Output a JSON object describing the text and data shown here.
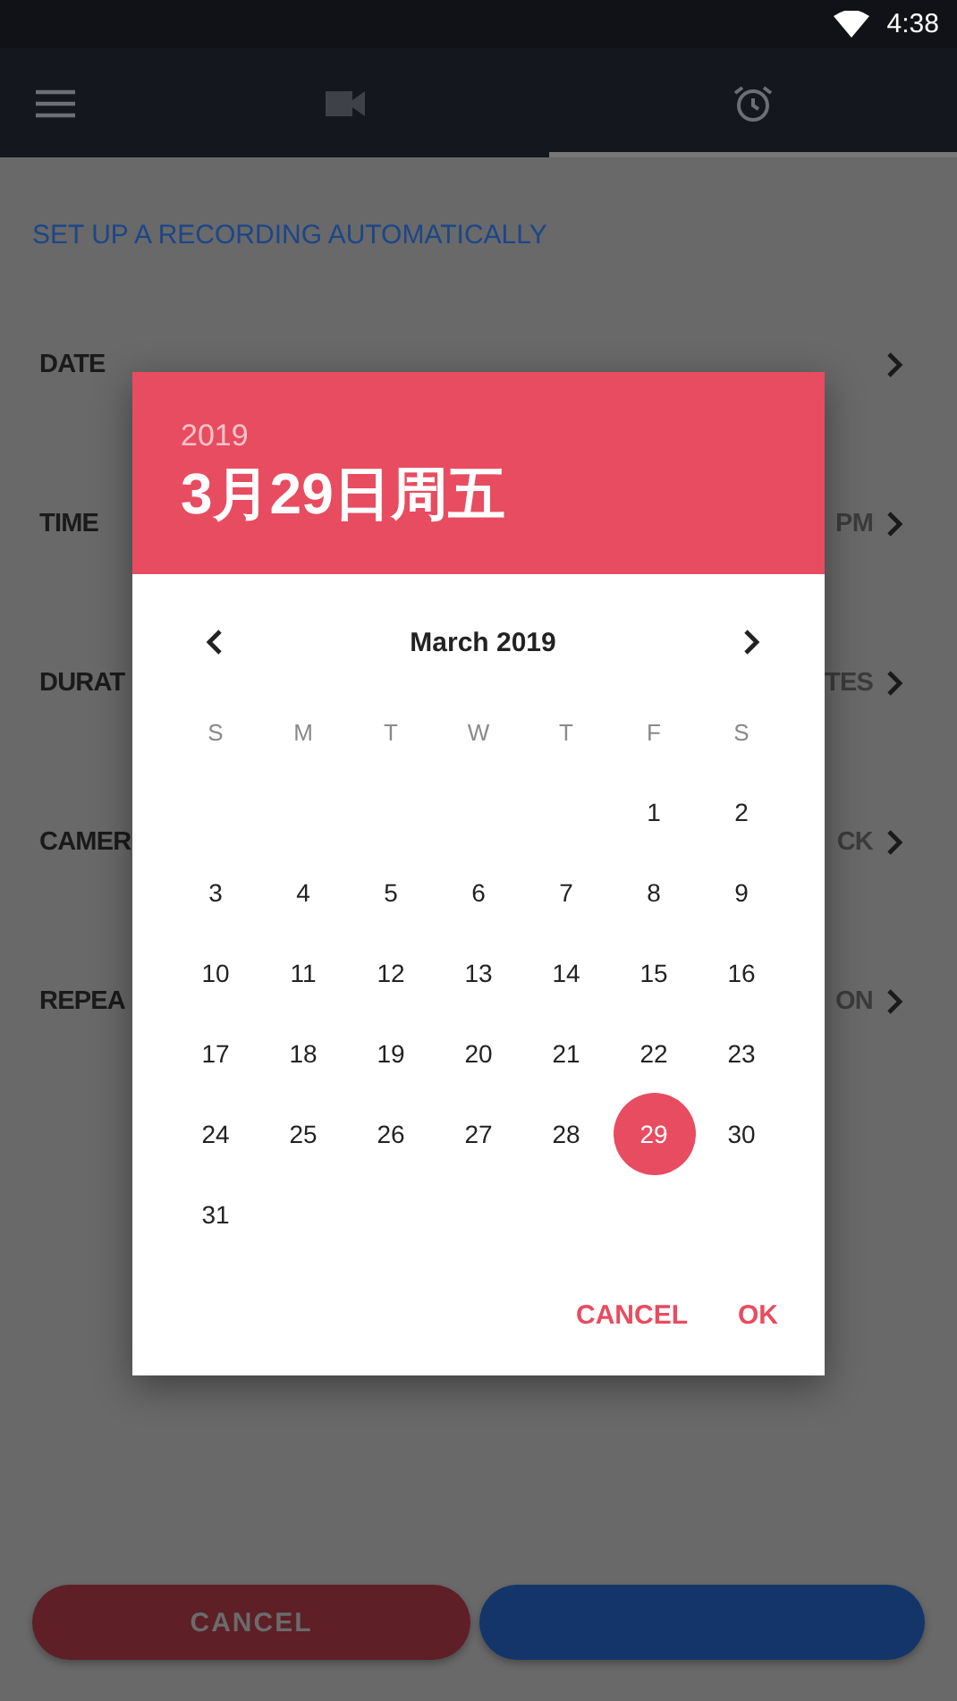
{
  "status_bar": {
    "time": "4:38"
  },
  "tabs": [
    {
      "kind": "video",
      "selected": false
    },
    {
      "kind": "alarm",
      "selected": true
    }
  ],
  "title": "SET UP A RECORDING AUTOMATICALLY",
  "settings": [
    {
      "label": "DATE"
    },
    {
      "label": "TIME",
      "value": "PM"
    },
    {
      "label": "DURAT",
      "value": "TES"
    },
    {
      "label": "CAMER",
      "value": "CK"
    },
    {
      "label": "REPEA",
      "value": "ON"
    }
  ],
  "date_picker": {
    "year": "2019",
    "date": "3月29日周五",
    "month": "March 2019",
    "weekdays": [
      "S",
      "M",
      "T",
      "W",
      "T",
      "F",
      "S"
    ],
    "weeks": [
      [
        {
          "day": "1",
          "selected": false
        },
        {
          "day": "2",
          "selected": false
        }
      ],
      [
        {
          "day": "3",
          "selected": false
        },
        {
          "day": "4",
          "selected": false
        },
        {
          "day": "5",
          "selected": false
        },
        {
          "day": "6",
          "selected": false
        },
        {
          "day": "7",
          "selected": false
        },
        {
          "day": "8",
          "selected": false
        },
        {
          "day": "9",
          "selected": false
        }
      ],
      [
        {
          "day": "10",
          "selected": false
        },
        {
          "day": "11",
          "selected": false
        },
        {
          "day": "12",
          "selected": false
        },
        {
          "day": "13",
          "selected": false
        },
        {
          "day": "14",
          "selected": false
        },
        {
          "day": "15",
          "selected": false
        },
        {
          "day": "16",
          "selected": false
        }
      ],
      [
        {
          "day": "17",
          "selected": false
        },
        {
          "day": "18",
          "selected": false
        },
        {
          "day": "19",
          "selected": false
        },
        {
          "day": "20",
          "selected": false
        },
        {
          "day": "21",
          "selected": false
        },
        {
          "day": "22",
          "selected": false
        },
        {
          "day": "23",
          "selected": false
        }
      ],
      [
        {
          "day": "24",
          "selected": false
        },
        {
          "day": "25",
          "selected": false
        },
        {
          "day": "26",
          "selected": false
        },
        {
          "day": "27",
          "selected": false
        },
        {
          "day": "28",
          "selected": false
        },
        {
          "day": "29",
          "selected": true
        },
        {
          "day": "30",
          "selected": false
        }
      ],
      [
        {
          "day": "31",
          "selected": false
        }
      ]
    ],
    "buttons": [
      "CANCEL",
      "OK"
    ]
  },
  "bottom_buttons": [
    {
      "kind": "cancel",
      "label": "CANCEL"
    },
    {
      "kind": "confirm"
    }
  ]
}
